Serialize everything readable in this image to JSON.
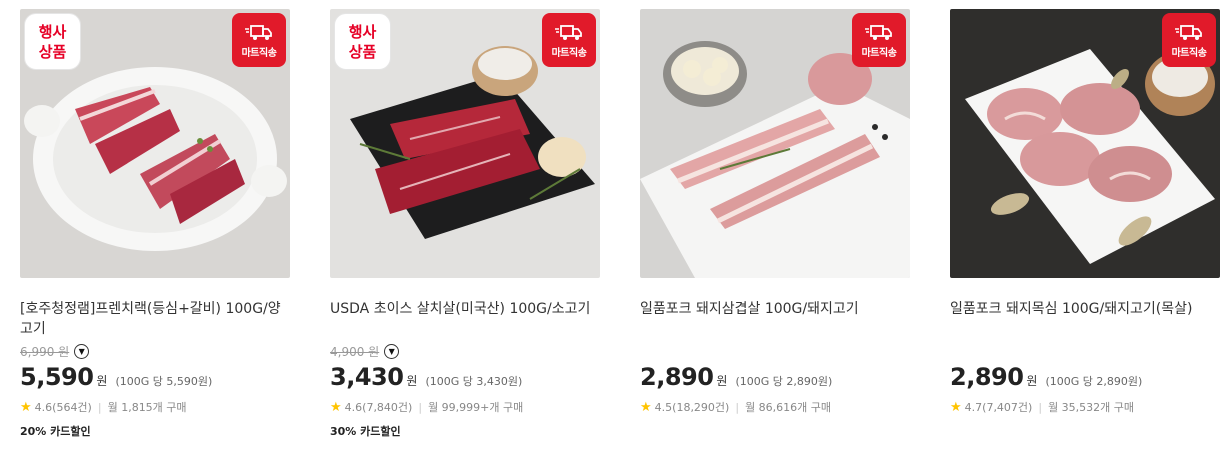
{
  "products": [
    {
      "event_badge": [
        "행사",
        "상품"
      ],
      "ship_badge": "마트직송",
      "title": "[호주청정램]프렌치랙(등심+갈비) 100G/양고기",
      "original_price": "6,990 원",
      "price": "5,590",
      "won": "원",
      "unit_price": "(100G 당 5,590원)",
      "rating": "4.6(564건)",
      "monthly": "월 1,815개 구매",
      "discount": "20% 카드할인"
    },
    {
      "event_badge": [
        "행사",
        "상품"
      ],
      "ship_badge": "마트직송",
      "title": "USDA 초이스 살치살(미국산) 100G/소고기",
      "original_price": "4,900 원",
      "price": "3,430",
      "won": "원",
      "unit_price": "(100G 당 3,430원)",
      "rating": "4.6(7,840건)",
      "monthly": "월 99,999+개 구매",
      "discount": "30% 카드할인"
    },
    {
      "ship_badge": "마트직송",
      "title": "일품포크 돼지삼겹살 100G/돼지고기",
      "price": "2,890",
      "won": "원",
      "unit_price": "(100G 당 2,890원)",
      "rating": "4.5(18,290건)",
      "monthly": "월 86,616개 구매"
    },
    {
      "ship_badge": "마트직송",
      "title": "일품포크 돼지목심 100G/돼지고기(목살)",
      "price": "2,890",
      "won": "원",
      "unit_price": "(100G 당 2,890원)",
      "rating": "4.7(7,407건)",
      "monthly": "월 35,532개 구매"
    }
  ]
}
